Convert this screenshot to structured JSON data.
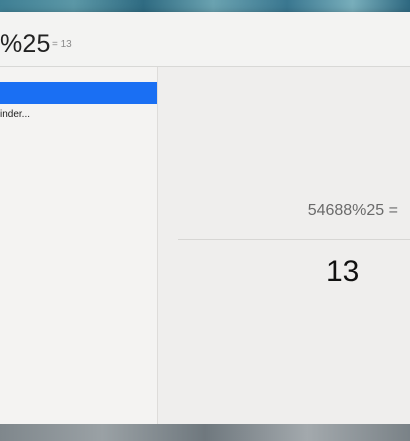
{
  "search": {
    "query": "%25",
    "inline_result": "= 13"
  },
  "results": {
    "items": [
      {
        "label": ""
      },
      {
        "label": "inder..."
      }
    ]
  },
  "preview": {
    "expression": "54688%25 =",
    "answer": "13"
  },
  "colors": {
    "selection": "#1a6ff3",
    "window_bg": "#f1f0ef"
  }
}
